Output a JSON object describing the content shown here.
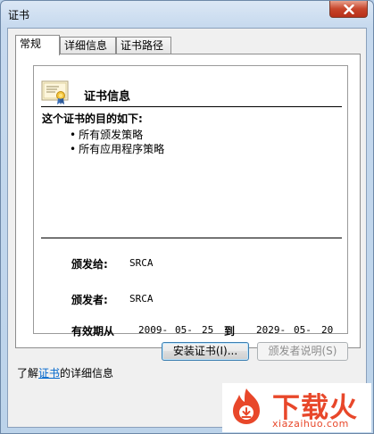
{
  "window": {
    "title": "证书"
  },
  "tabs": [
    {
      "label": "常规"
    },
    {
      "label": "详细信息"
    },
    {
      "label": "证书路径"
    }
  ],
  "certificate": {
    "header": "证书信息",
    "purpose_title": "这个证书的目的如下:",
    "purposes": [
      "所有颁发策略",
      "所有应用程序策略"
    ],
    "issued_to_label": "颁发给:",
    "issued_to_value": "SRCA",
    "issued_by_label": "颁发者:",
    "issued_by_value": "SRCA",
    "validity_label": "有效期从",
    "valid_from": {
      "year": "2009-",
      "month": "05-",
      "day": "25"
    },
    "to_label": "到",
    "valid_to": {
      "year": "2029-",
      "month": "05-",
      "day": "20"
    }
  },
  "buttons": {
    "install": "安装证书(I)...",
    "issuer_statement": "颁发者说明(S)"
  },
  "learn_more": {
    "prefix": "了解",
    "link": "证书",
    "suffix": "的详细信息"
  },
  "watermark": {
    "text": "下载火",
    "sub": "xiazaihuo.com"
  },
  "colors": {
    "link": "#0066cc",
    "close_button": "#c7452b",
    "watermark": "#e8472a"
  }
}
